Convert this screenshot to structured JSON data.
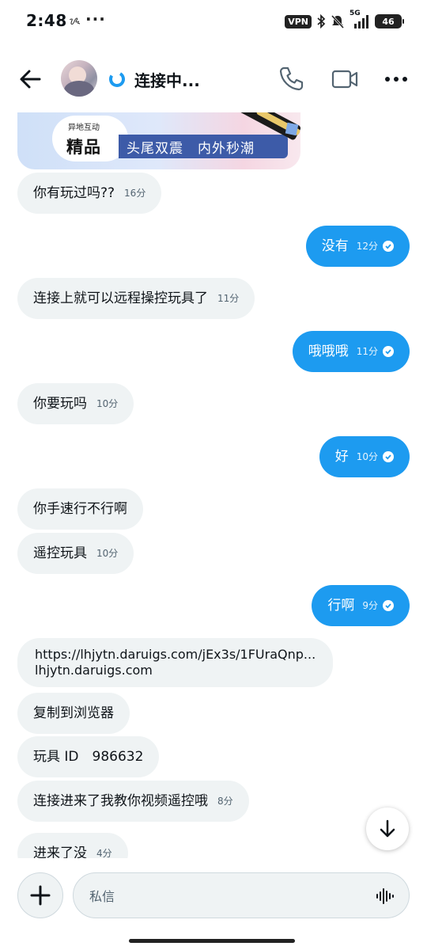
{
  "status_bar": {
    "time": "2:48",
    "symbol": "ᝰ",
    "dots": "···",
    "vpn": "VPN",
    "network": "5G",
    "battery": "46"
  },
  "header": {
    "title": "连接中...",
    "icons": [
      "back-arrow-icon",
      "loading-icon",
      "phone-icon",
      "video-camera-icon",
      "more-icon"
    ]
  },
  "banner": {
    "small_text": "异地互动",
    "big_text": "精品",
    "slogan": "头尾双震　内外秒潮"
  },
  "messages": [
    {
      "dir": "in",
      "text": "你有玩过吗??",
      "time": "16分"
    },
    {
      "dir": "out",
      "text": "没有",
      "time": "12分"
    },
    {
      "dir": "in",
      "text": "连接上就可以远程操控玩具了",
      "time": "11分"
    },
    {
      "dir": "out",
      "text": "哦哦哦",
      "time": "11分"
    },
    {
      "dir": "in",
      "text": "你要玩吗",
      "time": "10分"
    },
    {
      "dir": "out",
      "text": "好",
      "time": "10分"
    },
    {
      "dir": "in",
      "text": "你手速行不行啊",
      "time": ""
    },
    {
      "dir": "in",
      "text": "遥控玩具",
      "time": "10分"
    },
    {
      "dir": "out",
      "text": "行啊",
      "time": "9分"
    },
    {
      "dir": "in",
      "type": "link",
      "url": "https://lhjytn.daruigs.com/jEx3s/1FUraQnp...",
      "domain": "lhjytn.daruigs.com"
    },
    {
      "dir": "in",
      "text": "复制到浏览器",
      "time": ""
    },
    {
      "dir": "in",
      "text": "玩具 ID　986632",
      "time": ""
    },
    {
      "dir": "in",
      "text": "连接进来了我教你视频遥控哦",
      "time": "8分"
    },
    {
      "dir": "in",
      "text": "进来了没",
      "time": "4分"
    }
  ],
  "composer": {
    "placeholder": "私信"
  },
  "colors": {
    "accent": "#1d9bf0",
    "incoming_bubble": "#eff3f4",
    "text": "#0f1419",
    "muted": "#536471"
  }
}
